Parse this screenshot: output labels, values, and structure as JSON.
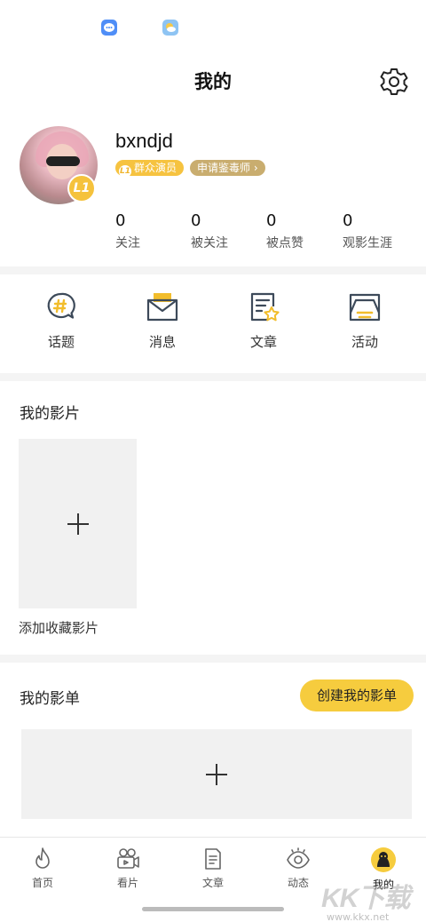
{
  "header": {
    "title": "我的"
  },
  "profile": {
    "username": "bxndjd",
    "level_badge": "L1",
    "role_tag_level": "L1",
    "role_tag": "群众演员",
    "apply_tag": "申请鉴毒师 ›",
    "stats": [
      {
        "value": "0",
        "label": "关注"
      },
      {
        "value": "0",
        "label": "被关注"
      },
      {
        "value": "0",
        "label": "被点赞"
      },
      {
        "value": "0",
        "label": "观影生涯"
      }
    ]
  },
  "quick_links": [
    {
      "label": "话题",
      "icon": "topic-hash-icon"
    },
    {
      "label": "消息",
      "icon": "message-envelope-icon"
    },
    {
      "label": "文章",
      "icon": "article-star-icon"
    },
    {
      "label": "活动",
      "icon": "activity-tray-icon"
    }
  ],
  "my_films": {
    "title": "我的影片",
    "add_label": "添加收藏影片"
  },
  "my_lists": {
    "title": "我的影单",
    "create_button": "创建我的影单"
  },
  "tabbar": [
    {
      "label": "首页",
      "icon": "flame-icon",
      "active": false
    },
    {
      "label": "看片",
      "icon": "film-camera-icon",
      "active": false
    },
    {
      "label": "文章",
      "icon": "document-icon",
      "active": false
    },
    {
      "label": "动态",
      "icon": "eye-icon",
      "active": false
    },
    {
      "label": "我的",
      "icon": "profile-face-icon",
      "active": true
    }
  ],
  "watermark": {
    "logo": "KK下载",
    "url": "www.kkx.net"
  },
  "colors": {
    "accent": "#f6cc3e",
    "apply_tag": "#c9ad6f",
    "divider": "#f4f4f4",
    "placeholder": "#f1f1f1"
  }
}
